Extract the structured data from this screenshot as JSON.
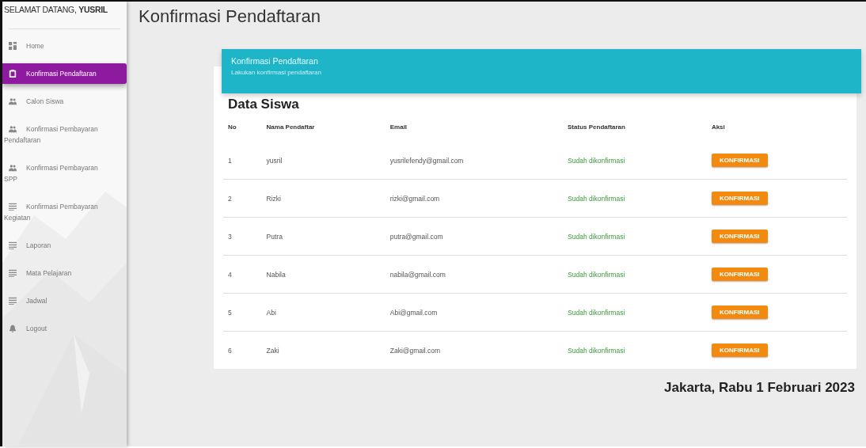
{
  "sidebar": {
    "welcome": "SELAMAT DATANG, **YUSRIL**",
    "items": [
      {
        "label": "Home",
        "kind": "grid",
        "selected": false
      },
      {
        "label": "Konfirmasi Pendaftaran",
        "kind": "clipboard",
        "selected": true
      },
      {
        "label": "Calon Siswa",
        "kind": "people",
        "selected": false
      },
      {
        "label": "Konfirmasi Pembayaran Pendaftaran",
        "kind": "people",
        "selected": false
      },
      {
        "label": "Konfirmasi Pembayaran SPP",
        "kind": "people",
        "selected": false
      },
      {
        "label": "Konfirmasi Pembayaran Kegiatan",
        "kind": "lines",
        "selected": false
      },
      {
        "label": "Laporan",
        "kind": "lines",
        "selected": false
      },
      {
        "label": "Mata Pelajaran",
        "kind": "lines",
        "selected": false
      },
      {
        "label": "Jadwal",
        "kind": "lines",
        "selected": false
      },
      {
        "label": "Logout",
        "kind": "bell",
        "selected": false
      }
    ]
  },
  "page_title": "Konfirmasi Pendaftaran",
  "card": {
    "title": "Konfirmasi Pendaftaran",
    "subtitle": "Lakukan konfirmasi pendaftaran"
  },
  "table": {
    "title": "Data Siswa",
    "columns": [
      "No",
      "Nama Pendaftar",
      "Email",
      "Status Pendaftaran",
      "Aksi"
    ],
    "rows": [
      {
        "no": "1",
        "name": "yusril",
        "email": "yusrilefendy@gmail.com",
        "status": "Sudah dikonfirmasi",
        "action": "KONFIRMASI"
      },
      {
        "no": "2",
        "name": "Rizki",
        "email": "rizki@gmail.com",
        "status": "Sudah dikonfirmasi",
        "action": "KONFIRMASI"
      },
      {
        "no": "3",
        "name": "Putra",
        "email": "putra@gmail.com",
        "status": "Sudah dikonfirmasi",
        "action": "KONFIRMASI"
      },
      {
        "no": "4",
        "name": "Nabila",
        "email": "nabila@gmail.com",
        "status": "Sudah dikonfirmasi",
        "action": "KONFIRMASI"
      },
      {
        "no": "5",
        "name": "Abi",
        "email": "Abi@gmail.com",
        "status": "Sudah dikonfirmasi",
        "action": "KONFIRMASI"
      },
      {
        "no": "6",
        "name": "Zaki",
        "email": "Zaki@gmail.com",
        "status": "Sudah dikonfirmasi",
        "action": "KONFIRMASI"
      }
    ]
  },
  "footer": "Jakarta, Rabu 1 Februari 2023"
}
